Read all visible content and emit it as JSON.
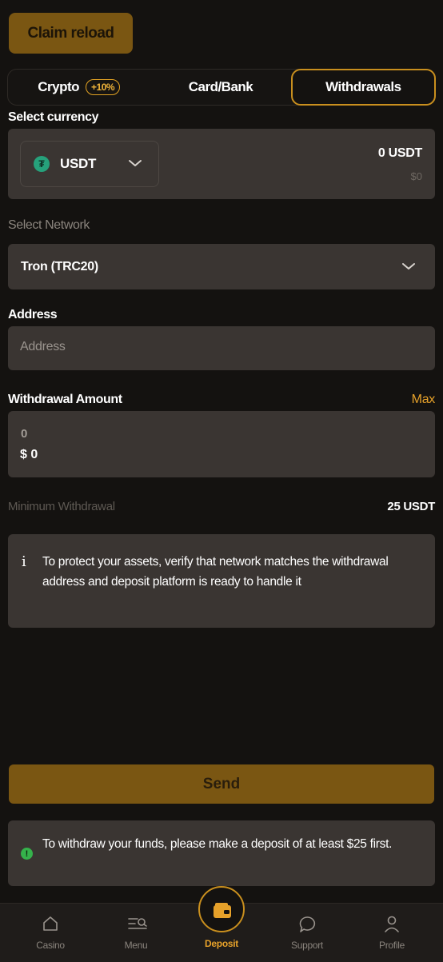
{
  "claim": {
    "label": "Claim reload"
  },
  "tabs": [
    {
      "label": "Crypto",
      "badge": "+10%"
    },
    {
      "label": "Card/Bank"
    },
    {
      "label": "Withdrawals",
      "active": true
    }
  ],
  "currency": {
    "section_label": "Select currency",
    "code": "USDT",
    "icon": "tether-icon",
    "balance": "0 USDT",
    "balance_usd": "$0"
  },
  "network": {
    "section_label": "Select Network",
    "value": "Tron (TRC20)"
  },
  "address": {
    "section_label": "Address",
    "placeholder": "Address"
  },
  "amount": {
    "section_label": "Withdrawal Amount",
    "max_label": "Max",
    "crypto_value": "0",
    "usd_value": "$ 0"
  },
  "minimum": {
    "label": "Minimum Withdrawal",
    "value": "25 USDT"
  },
  "info": {
    "text": "To protect your assets, verify that network matches the withdrawal address and deposit platform is ready to handle it"
  },
  "send": {
    "label": "Send"
  },
  "warning": {
    "text": "To withdraw your funds, please make a deposit of at least $25 first."
  },
  "nav": [
    {
      "label": "Casino",
      "icon": "home-icon"
    },
    {
      "label": "Menu",
      "icon": "menu-search-icon"
    },
    {
      "label": "Deposit",
      "icon": "wallet-icon",
      "active": true
    },
    {
      "label": "Support",
      "icon": "chat-icon"
    },
    {
      "label": "Profile",
      "icon": "user-icon"
    }
  ],
  "colors": {
    "accent": "#e6a12a",
    "button": "#7a5612",
    "panel": "#3a3532",
    "background": "#141210",
    "success": "#35b24b"
  }
}
